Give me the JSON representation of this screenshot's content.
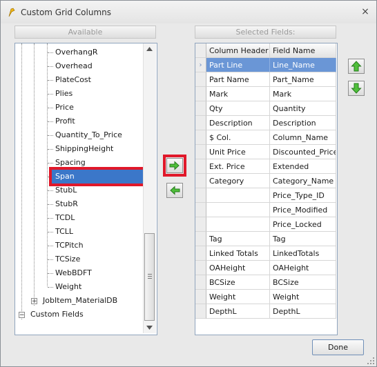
{
  "dialog": {
    "title": "Custom Grid Columns",
    "close_label": "×"
  },
  "available": {
    "header": "Available",
    "tree_items": [
      {
        "label": "OverhangR"
      },
      {
        "label": "Overhead"
      },
      {
        "label": "PlateCost"
      },
      {
        "label": "Plies"
      },
      {
        "label": "Price"
      },
      {
        "label": "Profit"
      },
      {
        "label": "Quantity_To_Price"
      },
      {
        "label": "ShippingHeight"
      },
      {
        "label": "Spacing"
      },
      {
        "label": "Span",
        "selected": true
      },
      {
        "label": "StubL"
      },
      {
        "label": "StubR"
      },
      {
        "label": "TCDL"
      },
      {
        "label": "TCLL"
      },
      {
        "label": "TCPitch"
      },
      {
        "label": "TCSize"
      },
      {
        "label": "WebBDFT"
      },
      {
        "label": "Weight"
      }
    ],
    "parent_items": [
      {
        "label": "JobItem_MaterialDB",
        "expander": "+"
      },
      {
        "label": "Custom Fields",
        "expander": "−"
      }
    ]
  },
  "selected": {
    "header": "Selected Fields:",
    "columns": [
      "Column Header",
      "Field Name"
    ],
    "rows": [
      {
        "header": "Part Line",
        "field": "Line_Name",
        "selected": true
      },
      {
        "header": "Part Name",
        "field": "Part_Name"
      },
      {
        "header": "Mark",
        "field": "Mark"
      },
      {
        "header": "Qty",
        "field": "Quantity"
      },
      {
        "header": "Description",
        "field": "Description"
      },
      {
        "header": "$ Col.",
        "field": "Column_Name"
      },
      {
        "header": "Unit Price",
        "field": "Discounted_Price"
      },
      {
        "header": "Ext. Price",
        "field": "Extended"
      },
      {
        "header": "Category",
        "field": "Category_Name"
      },
      {
        "header": "",
        "field": "Price_Type_ID"
      },
      {
        "header": "",
        "field": "Price_Modified"
      },
      {
        "header": "",
        "field": "Price_Locked"
      },
      {
        "header": "Tag",
        "field": "Tag"
      },
      {
        "header": "Linked Totals",
        "field": "LinkedTotals"
      },
      {
        "header": "OAHeight",
        "field": "OAHeight"
      },
      {
        "header": "BCSize",
        "field": "BCSize"
      },
      {
        "header": "Weight",
        "field": "Weight"
      },
      {
        "header": "DepthL",
        "field": "DepthL"
      }
    ]
  },
  "buttons": {
    "done": "Done",
    "add_icon": "arrow-right-icon",
    "remove_icon": "arrow-left-icon",
    "up_icon": "arrow-up-icon",
    "down_icon": "arrow-down-icon"
  },
  "colors": {
    "selection": "#3b77c9",
    "grid_selection": "#6a96d6",
    "highlight_outline": "#e0182a",
    "arrow_green": "#3aa62e"
  }
}
